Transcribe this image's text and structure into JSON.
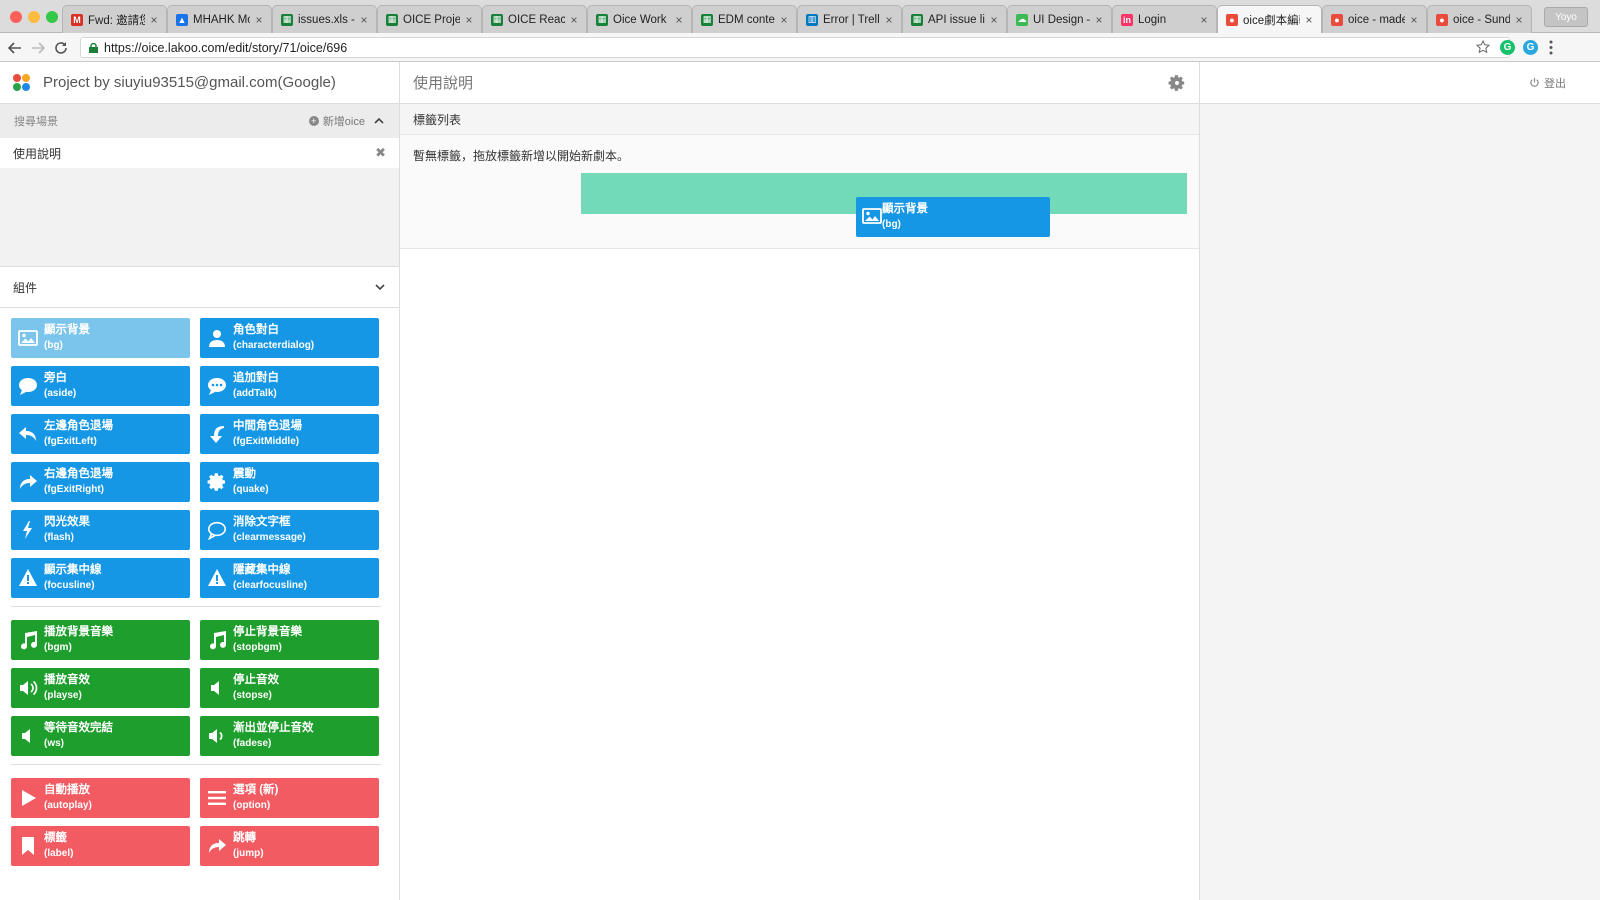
{
  "browser": {
    "tabs": [
      {
        "title": "Fwd: 邀請您",
        "favicon": "gmail-icon",
        "color": "#d93025"
      },
      {
        "title": "MHAHK Mob",
        "favicon": "drive-icon",
        "color": "#1a73e8"
      },
      {
        "title": "issues.xls - Goo",
        "favicon": "sheets-icon",
        "color": "#188038"
      },
      {
        "title": "OICE Project",
        "favicon": "sheets-icon",
        "color": "#188038"
      },
      {
        "title": "OICE React D",
        "favicon": "sheets-icon",
        "color": "#188038"
      },
      {
        "title": "Oice Work Re",
        "favicon": "sheets-icon",
        "color": "#188038"
      },
      {
        "title": "EDM content",
        "favicon": "sheets-icon",
        "color": "#188038"
      },
      {
        "title": "Error | Trello",
        "favicon": "trello-icon",
        "color": "#0079bf"
      },
      {
        "title": "API issue list",
        "favicon": "sheets-icon",
        "color": "#188038"
      },
      {
        "title": "UI Design – I",
        "favicon": "cloud-icon",
        "color": "#3cba54"
      },
      {
        "title": "Login",
        "favicon": "invision-icon",
        "color": "#ff3366"
      },
      {
        "title": "oice劇本編輯",
        "favicon": "oice-icon",
        "color": "#e94b3c",
        "active": true
      },
      {
        "title": "oice - made",
        "favicon": "oice-icon",
        "color": "#e94b3c"
      },
      {
        "title": "oice - Sunda",
        "favicon": "oice-icon",
        "color": "#e94b3c"
      }
    ],
    "tab_close_glyph": "×",
    "user_chip": "Yoyo",
    "url": "https://oice.lakoo.com/edit/story/71/oice/696"
  },
  "project": {
    "title": "Project by siuyiu93515@gmail.com(Google)"
  },
  "scenes": {
    "search_label": "搜尋場景",
    "add_label": "新增oice",
    "items": [
      {
        "name": "使用說明"
      }
    ]
  },
  "components": {
    "header": "組件",
    "groups": [
      {
        "color": "blue",
        "rows": [
          [
            {
              "name": "顯示背景",
              "code": "(bg)",
              "icon": "image-icon",
              "selected": true
            },
            {
              "name": "角色對白",
              "code": "(characterdialog)",
              "icon": "person-icon"
            }
          ],
          [
            {
              "name": "旁白",
              "code": "(aside)",
              "icon": "speech-bubble-icon"
            },
            {
              "name": "追加對白",
              "code": "(addTalk)",
              "icon": "dots-bubble-icon"
            }
          ],
          [
            {
              "name": "左邊角色退場",
              "code": "(fgExitLeft)",
              "icon": "reply-left-icon"
            },
            {
              "name": "中間角色退場",
              "code": "(fgExitMiddle)",
              "icon": "exit-down-icon"
            }
          ],
          [
            {
              "name": "右邊角色退場",
              "code": "(fgExitRight)",
              "icon": "share-right-icon"
            },
            {
              "name": "震動",
              "code": "(quake)",
              "icon": "gear-icon"
            }
          ],
          [
            {
              "name": "閃光效果",
              "code": "(flash)",
              "icon": "lightning-icon"
            },
            {
              "name": "消除文字框",
              "code": "(clearmessage)",
              "icon": "empty-bubble-icon"
            }
          ],
          [
            {
              "name": "顯示集中線",
              "code": "(focusline)",
              "icon": "warning-icon"
            },
            {
              "name": "隱藏集中線",
              "code": "(clearfocusline)",
              "icon": "warning-icon"
            }
          ]
        ]
      },
      {
        "color": "green",
        "rows": [
          [
            {
              "name": "播放背景音樂",
              "code": "(bgm)",
              "icon": "music-note-icon"
            },
            {
              "name": "停止背景音樂",
              "code": "(stopbgm)",
              "icon": "music-note-icon"
            }
          ],
          [
            {
              "name": "播放音效",
              "code": "(playse)",
              "icon": "volume-up-icon"
            },
            {
              "name": "停止音效",
              "code": "(stopse)",
              "icon": "volume-off-icon"
            }
          ],
          [
            {
              "name": "等待音效完結",
              "code": "(ws)",
              "icon": "volume-off-icon"
            },
            {
              "name": "漸出並停止音效",
              "code": "(fadese)",
              "icon": "volume-down-icon"
            }
          ]
        ]
      },
      {
        "color": "red",
        "rows": [
          [
            {
              "name": "自動播放",
              "code": "(autoplay)",
              "icon": "play-icon"
            },
            {
              "name": "選項 (新)",
              "code": "(option)",
              "icon": "menu-lines-icon"
            }
          ],
          [
            {
              "name": "標籤",
              "code": "(label)",
              "icon": "bookmark-icon"
            },
            {
              "name": "跳轉",
              "code": "(jump)",
              "icon": "share-right-icon"
            }
          ]
        ]
      }
    ]
  },
  "story": {
    "title": "使用說明",
    "tag_list_label": "標籤列表",
    "empty_message": "暫無標籤，拖放標籤新增以開始新劇本。",
    "dragging_block": {
      "name": "顯示背景",
      "code": "(bg)",
      "icon": "image-icon"
    }
  },
  "account": {
    "logout_label": "登出"
  },
  "colors": {
    "blue": "#1597e5",
    "blue_selected": "#7bc4ec",
    "green": "#1e9e2c",
    "red": "#f35b62",
    "drop_zone": "#72d9b9"
  }
}
